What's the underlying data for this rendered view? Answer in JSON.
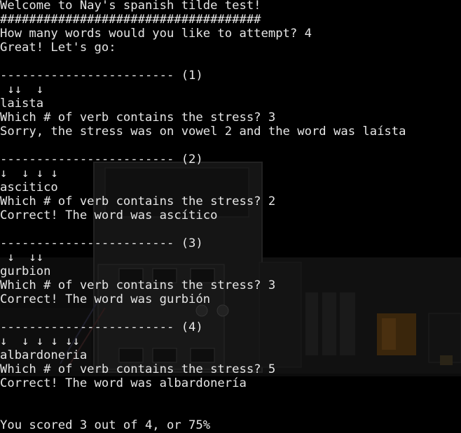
{
  "colors": {
    "background": "#000000",
    "text": "#e6e6e6"
  },
  "terminal": {
    "lines": [
      "Welcome to Nay's spanish tilde test!",
      "####################################",
      "How many words would you like to attempt? 4",
      "Great! Let's go:",
      "",
      "------------------------ (1)",
      " ↓↓  ↓",
      "laista",
      "Which # of verb contains the stress? 3",
      "Sorry, the stress was on vowel 2 and the word was laísta",
      "",
      "------------------------ (2)",
      "↓  ↓ ↓ ↓",
      "ascitico",
      "Which # of verb contains the stress? 2",
      "Correct! The word was ascítico",
      "",
      "------------------------ (3)",
      " ↓  ↓↓",
      "gurbion",
      "Which # of verb contains the stress? 3",
      "Correct! The word was gurbión",
      "",
      "------------------------ (4)",
      "↓  ↓ ↓ ↓ ↓↓",
      "albardoneria",
      "Which # of verb contains the stress? 5",
      "Correct! The word was albardonería",
      "",
      "",
      "You scored 3 out of 4, or 75%"
    ]
  }
}
